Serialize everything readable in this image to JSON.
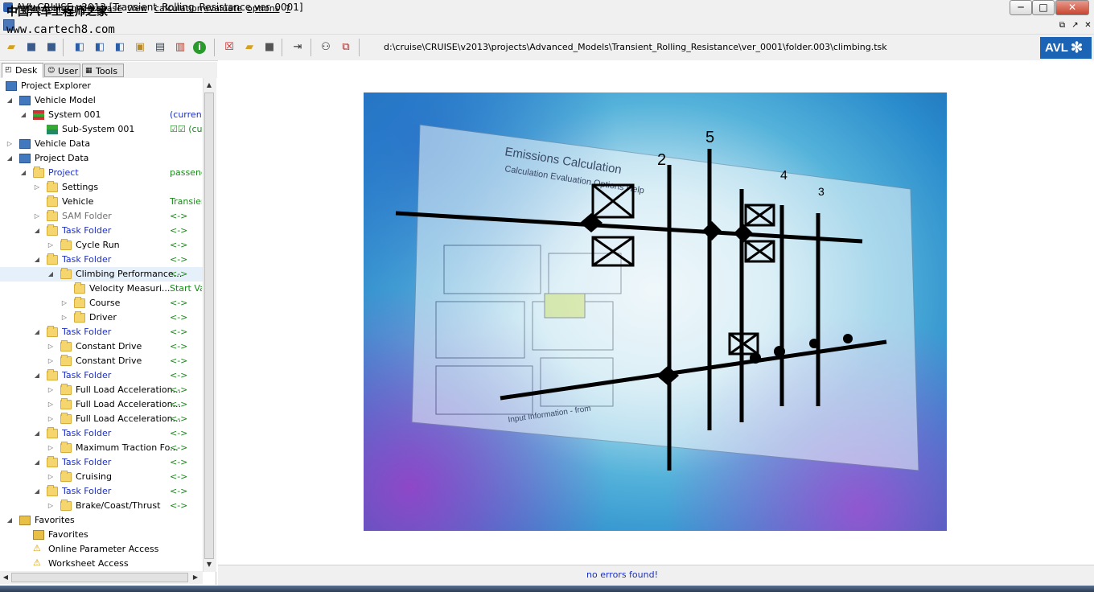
{
  "window": {
    "title": "AVL CRUISE v2013 [Transient_Rolling_Resistance ver_0001]",
    "watermark_text": "中国汽车工程师之家",
    "watermark_url": "www.cartech8.com",
    "minimize": "─",
    "maximize": "□",
    "close": "✕"
  },
  "menu": {
    "items": [
      "file",
      "object",
      "database",
      "view",
      "calculation",
      "evaluate",
      "options",
      "?"
    ]
  },
  "mdi": {
    "restore": "⧉",
    "pin": "↗",
    "close": "✕"
  },
  "toolbar": {
    "path": "d:\\cruise\\CRUISE\\v2013\\projects\\Advanced_Models\\Transient_Rolling_Resistance\\ver_0001\\folder.003\\climbing.tsk",
    "logo": "AVL",
    "icons": [
      "open-folder-icon",
      "save-icon",
      "save-as-icon",
      "model-icon",
      "model-add-icon",
      "model-run-icon",
      "package-icon",
      "monitor-icon",
      "chart-icon",
      "info-icon",
      "delete-icon",
      "open-icon",
      "save2-icon",
      "export-icon",
      "binoculars-icon",
      "compare-icon"
    ]
  },
  "tabs": [
    {
      "label": "Desk",
      "active": true
    },
    {
      "label": "User",
      "active": false
    },
    {
      "label": "Tools",
      "active": false
    }
  ],
  "tree": [
    {
      "label": "Project Explorer",
      "status": "",
      "color": "black"
    },
    {
      "label": "Vehicle Model",
      "status": "",
      "color": "black"
    },
    {
      "label": "System 001",
      "status": "(current",
      "color": "black"
    },
    {
      "label": "Sub-System 001",
      "status": "☑☑ (cu",
      "color": "black"
    },
    {
      "label": "Vehicle Data",
      "status": "",
      "color": "black"
    },
    {
      "label": "Project Data",
      "status": "",
      "color": "black"
    },
    {
      "label": "Project",
      "status": "passeng",
      "color": "blue"
    },
    {
      "label": "Settings",
      "status": "",
      "color": "black"
    },
    {
      "label": "Vehicle",
      "status": "Transien",
      "color": "black"
    },
    {
      "label": "SAM Folder",
      "status": "<->",
      "color": "gray"
    },
    {
      "label": "Task Folder",
      "status": "<->",
      "color": "blue"
    },
    {
      "label": "Cycle Run",
      "status": "<->",
      "color": "black"
    },
    {
      "label": "Task Folder",
      "status": "<->",
      "color": "blue"
    },
    {
      "label": "Climbing Performance...",
      "status": "<->",
      "color": "black"
    },
    {
      "label": "Velocity Measuri...",
      "status": "Start Va",
      "color": "black"
    },
    {
      "label": "Course",
      "status": "<->",
      "color": "black"
    },
    {
      "label": "Driver",
      "status": "<->",
      "color": "black"
    },
    {
      "label": "Task Folder",
      "status": "<->",
      "color": "blue"
    },
    {
      "label": "Constant Drive",
      "status": "<->",
      "color": "black"
    },
    {
      "label": "Constant Drive",
      "status": "<->",
      "color": "black"
    },
    {
      "label": "Task Folder",
      "status": "<->",
      "color": "blue"
    },
    {
      "label": "Full Load Acceleration...",
      "status": "<->",
      "color": "black"
    },
    {
      "label": "Full Load Acceleration...",
      "status": "<->",
      "color": "black"
    },
    {
      "label": "Full Load Acceleration...",
      "status": "<->",
      "color": "black"
    },
    {
      "label": "Task Folder",
      "status": "<->",
      "color": "blue"
    },
    {
      "label": "Maximum Traction Fo...",
      "status": "<->",
      "color": "black"
    },
    {
      "label": "Task Folder",
      "status": "<->",
      "color": "blue"
    },
    {
      "label": "Cruising",
      "status": "<->",
      "color": "black"
    },
    {
      "label": "Task Folder",
      "status": "<->",
      "color": "blue"
    },
    {
      "label": "Brake/Coast/Thrust",
      "status": "<->",
      "color": "black"
    },
    {
      "label": "Favorites",
      "status": "",
      "color": "black"
    },
    {
      "label": "Favorites",
      "status": "",
      "color": "black"
    },
    {
      "label": "Online Parameter Access",
      "status": "",
      "color": "black"
    },
    {
      "label": "Worksheet Access",
      "status": "",
      "color": "black"
    }
  ],
  "splash": {
    "title": "Emissions Calculation",
    "menu_text": "Calculation   Evaluation   Options   Help",
    "gear_labels": [
      "2",
      "5",
      "4",
      "3"
    ],
    "footer_text": "Input Information - from"
  },
  "status": {
    "message": "no errors found!"
  },
  "colors": {
    "accent_blue": "#1c2fc4",
    "status_green": "#1a8a1a",
    "avl_blue": "#1b63b4"
  }
}
